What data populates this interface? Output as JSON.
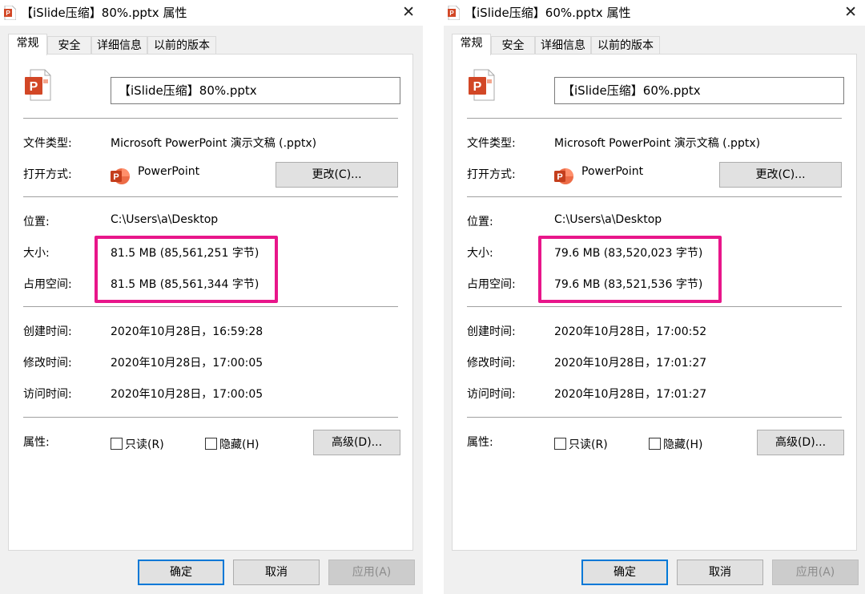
{
  "dialogs": [
    {
      "title": "【iSlide压缩】80%.pptx 属性",
      "close_glyph": "✕",
      "tabs": [
        {
          "label": "常规",
          "active": true
        },
        {
          "label": "安全",
          "active": false
        },
        {
          "label": "详细信息",
          "active": false
        },
        {
          "label": "以前的版本",
          "active": false
        }
      ],
      "file_name": "【iSlide压缩】80%.pptx",
      "file_type_label": "文件类型:",
      "file_type_value": "Microsoft PowerPoint 演示文稿 (.pptx)",
      "open_with_label": "打开方式:",
      "open_with_app": "PowerPoint",
      "change_button": "更改(C)...",
      "location_label": "位置:",
      "location_value": "C:\\Users\\a\\Desktop",
      "size_label": "大小:",
      "size_value": "81.5 MB (85,561,251 字节)",
      "disk_size_label": "占用空间:",
      "disk_size_value": "81.5 MB (85,561,344 字节)",
      "created_label": "创建时间:",
      "created_value": "2020年10月28日，16:59:28",
      "modified_label": "修改时间:",
      "modified_value": "2020年10月28日，17:00:05",
      "accessed_label": "访问时间:",
      "accessed_value": "2020年10月28日，17:00:05",
      "attributes_label": "属性:",
      "readonly_label": "只读(R)",
      "hidden_label": "隐藏(H)",
      "advanced_button": "高级(D)...",
      "ok_button": "确定",
      "cancel_button": "取消",
      "apply_button": "应用(A)"
    },
    {
      "title": "【iSlide压缩】60%.pptx 属性",
      "close_glyph": "✕",
      "tabs": [
        {
          "label": "常规",
          "active": true
        },
        {
          "label": "安全",
          "active": false
        },
        {
          "label": "详细信息",
          "active": false
        },
        {
          "label": "以前的版本",
          "active": false
        }
      ],
      "file_name": "【iSlide压缩】60%.pptx",
      "file_type_label": "文件类型:",
      "file_type_value": "Microsoft PowerPoint 演示文稿 (.pptx)",
      "open_with_label": "打开方式:",
      "open_with_app": "PowerPoint",
      "change_button": "更改(C)...",
      "location_label": "位置:",
      "location_value": "C:\\Users\\a\\Desktop",
      "size_label": "大小:",
      "size_value": "79.6 MB (83,520,023 字节)",
      "disk_size_label": "占用空间:",
      "disk_size_value": "79.6 MB (83,521,536 字节)",
      "created_label": "创建时间:",
      "created_value": "2020年10月28日，17:00:52",
      "modified_label": "修改时间:",
      "modified_value": "2020年10月28日，17:01:27",
      "accessed_label": "访问时间:",
      "accessed_value": "2020年10月28日，17:01:27",
      "attributes_label": "属性:",
      "readonly_label": "只读(R)",
      "hidden_label": "隐藏(H)",
      "advanced_button": "高级(D)...",
      "ok_button": "确定",
      "cancel_button": "取消",
      "apply_button": "应用(A)"
    }
  ],
  "colors": {
    "highlight_box": "#e8168a",
    "powerpoint_orange": "#d24726",
    "default_button_border": "#0078d7"
  },
  "icons": [
    "powerpoint-file-icon",
    "powerpoint-app-icon",
    "close-icon",
    "checkbox-icon"
  ]
}
